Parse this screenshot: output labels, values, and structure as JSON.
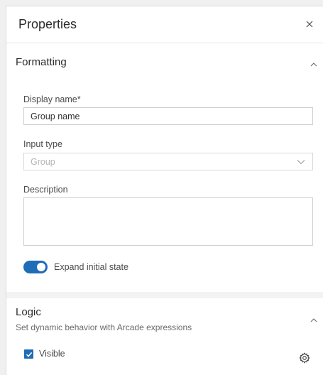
{
  "header": {
    "title": "Properties",
    "close_icon": "close-icon"
  },
  "formatting": {
    "title": "Formatting",
    "chevron_icon": "chevron-up-icon",
    "display_name": {
      "label": "Display name*",
      "value": "Group name"
    },
    "input_type": {
      "label": "Input type",
      "value": "Group",
      "chevron_icon": "chevron-down-icon"
    },
    "description": {
      "label": "Description",
      "value": ""
    },
    "expand_toggle": {
      "label": "Expand initial state",
      "checked": true
    }
  },
  "logic": {
    "title": "Logic",
    "subtitle": "Set dynamic behavior with Arcade expressions",
    "chevron_icon": "chevron-up-icon",
    "visible": {
      "label": "Visible",
      "checked": true,
      "settings_icon": "gear-icon"
    }
  },
  "colors": {
    "accent": "#1f6cb8",
    "section_gap": "#f3f3f3",
    "border": "#cfcfcf"
  }
}
